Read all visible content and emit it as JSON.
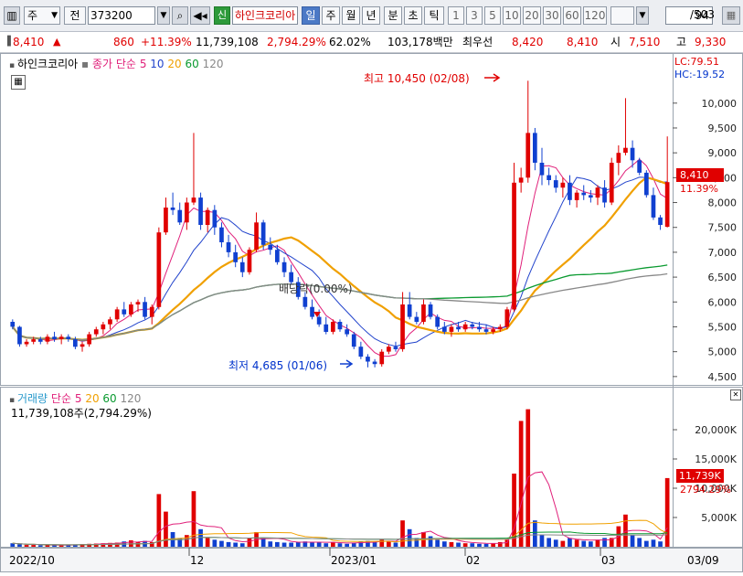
{
  "toolbar": {
    "market": "주",
    "jeon": "전",
    "code": "373200",
    "sin_badge": "신",
    "stock_name": "하인크코리아",
    "periods": [
      "일",
      "주",
      "월",
      "년",
      "분",
      "초",
      "틱"
    ],
    "selected_period": "일",
    "intervals": [
      "1",
      "3",
      "5",
      "10",
      "20",
      "30",
      "60",
      "120"
    ],
    "page": "94",
    "page_total": "/503"
  },
  "quote": {
    "price": "8,410",
    "up_mark": "▲",
    "change": "860",
    "change_rate": "+11.39%",
    "volume": "11,739,108",
    "volume_rate": "2,794.29%",
    "turnover": "62.02%",
    "amount": "103,178백만",
    "best_bid_label": "최우선",
    "best_bid": "8,420",
    "best_ask": "8,410",
    "open_label": "시",
    "open": "7,510",
    "high_label": "고",
    "high": "9,330"
  },
  "chart": {
    "name_label": "하인크코리아",
    "ma_label": "종가 단순",
    "ma_periods": [
      "5",
      "10",
      "20",
      "60",
      "120"
    ],
    "ma_colors": [
      "#e0207a",
      "#2244cc",
      "#f0a000",
      "#0a9a30",
      "#888888"
    ],
    "lc": "LC:79.51",
    "hc": "HC:-19.52",
    "annotation_high": "최고 10,450 (02/08)",
    "annotation_low": "최저 4,685 (01/06)",
    "annotation_ex_div": "배당락(0.00%)",
    "current_price_tag": "8,410",
    "current_rate_tag": "11.39%",
    "volume_label": "거래량",
    "volume_ma_label": "단순",
    "volume_ma_periods": [
      "5",
      "20",
      "60",
      "120"
    ],
    "volume_value": "11,739,108주(2,794.29%)",
    "volume_tag": "11,739K",
    "volume_rate_tag": "2794.29%",
    "date_labels": [
      "2022/10",
      "12",
      "2023/01",
      "02",
      "03",
      "03/09"
    ]
  },
  "chart_data": [
    {
      "type": "candlestick",
      "yaxis_ticks": [
        "10,000",
        "9,500",
        "9,000",
        "8,500",
        "8,000",
        "7,500",
        "7,000",
        "6,500",
        "6,000",
        "5,500",
        "5,000",
        "4,500"
      ],
      "ylim": [
        4350,
        10750
      ],
      "bars": [
        [
          5600,
          5650,
          5450,
          5500
        ],
        [
          5500,
          5520,
          5100,
          5150
        ],
        [
          5150,
          5250,
          5100,
          5200
        ],
        [
          5200,
          5300,
          5150,
          5250
        ],
        [
          5250,
          5300,
          5150,
          5200
        ],
        [
          5200,
          5350,
          5150,
          5300
        ],
        [
          5300,
          5400,
          5200,
          5250
        ],
        [
          5250,
          5350,
          5150,
          5300
        ],
        [
          5300,
          5350,
          5200,
          5250
        ],
        [
          5250,
          5300,
          5050,
          5100
        ],
        [
          5100,
          5200,
          5000,
          5150
        ],
        [
          5150,
          5400,
          5100,
          5350
        ],
        [
          5350,
          5500,
          5300,
          5450
        ],
        [
          5450,
          5600,
          5350,
          5550
        ],
        [
          5550,
          5700,
          5450,
          5650
        ],
        [
          5650,
          5900,
          5600,
          5850
        ],
        [
          5850,
          6000,
          5700,
          5750
        ],
        [
          5750,
          6000,
          5700,
          5950
        ],
        [
          5950,
          6050,
          5800,
          6000
        ],
        [
          6000,
          6100,
          5650,
          5700
        ],
        [
          5700,
          5950,
          5550,
          5900
        ],
        [
          5900,
          7500,
          5850,
          7400
        ],
        [
          7400,
          8100,
          7350,
          7900
        ],
        [
          7900,
          8200,
          7750,
          7850
        ],
        [
          7850,
          8000,
          7550,
          7600
        ],
        [
          7600,
          8100,
          7450,
          8000
        ],
        [
          8000,
          9400,
          7950,
          8100
        ],
        [
          8100,
          8200,
          7450,
          7550
        ],
        [
          7550,
          7900,
          7400,
          7850
        ],
        [
          7850,
          7950,
          7350,
          7500
        ],
        [
          7500,
          7600,
          7100,
          7200
        ],
        [
          7200,
          7350,
          6900,
          7000
        ],
        [
          7000,
          7150,
          6700,
          6800
        ],
        [
          6800,
          6900,
          6500,
          6600
        ],
        [
          6600,
          7100,
          6550,
          7050
        ],
        [
          7050,
          7800,
          7000,
          7600
        ],
        [
          7600,
          7650,
          7050,
          7150
        ],
        [
          7150,
          7300,
          6950,
          7050
        ],
        [
          7050,
          7150,
          6750,
          6800
        ],
        [
          6800,
          6900,
          6500,
          6600
        ],
        [
          6600,
          6750,
          6350,
          6400
        ],
        [
          6400,
          6500,
          6050,
          6100
        ],
        [
          6100,
          6200,
          5850,
          5900
        ],
        [
          5900,
          6050,
          5650,
          5700
        ],
        [
          5700,
          5850,
          5500,
          5550
        ],
        [
          5550,
          5700,
          5350,
          5400
        ],
        [
          5400,
          5650,
          5350,
          5600
        ],
        [
          5600,
          5650,
          5400,
          5450
        ],
        [
          5450,
          5550,
          5300,
          5350
        ],
        [
          5350,
          5400,
          5050,
          5100
        ],
        [
          5100,
          5200,
          4850,
          4900
        ],
        [
          4900,
          4950,
          4685,
          4800
        ],
        [
          4800,
          4850,
          4685,
          4750
        ],
        [
          4750,
          5050,
          4700,
          5000
        ],
        [
          5000,
          5150,
          4950,
          5100
        ],
        [
          5100,
          5200,
          5000,
          5050
        ],
        [
          5050,
          6200,
          5000,
          5950
        ],
        [
          5950,
          6200,
          5650,
          5700
        ],
        [
          5700,
          5800,
          5550,
          5600
        ],
        [
          5600,
          6050,
          5550,
          5950
        ],
        [
          5950,
          6000,
          5650,
          5700
        ],
        [
          5700,
          5750,
          5450,
          5500
        ],
        [
          5500,
          5600,
          5350,
          5400
        ],
        [
          5400,
          5550,
          5300,
          5500
        ],
        [
          5500,
          5600,
          5400,
          5450
        ],
        [
          5450,
          5600,
          5400,
          5550
        ],
        [
          5550,
          5600,
          5450,
          5500
        ],
        [
          5500,
          5600,
          5400,
          5450
        ],
        [
          5450,
          5550,
          5350,
          5400
        ],
        [
          5400,
          5500,
          5350,
          5450
        ],
        [
          5450,
          5550,
          5400,
          5500
        ],
        [
          5500,
          5900,
          5450,
          5850
        ],
        [
          5850,
          8800,
          5800,
          8400
        ],
        [
          8400,
          8700,
          8200,
          8500
        ],
        [
          8500,
          10450,
          8400,
          9400
        ],
        [
          9400,
          9500,
          8650,
          8800
        ],
        [
          8800,
          9100,
          8350,
          8550
        ],
        [
          8550,
          8700,
          8350,
          8450
        ],
        [
          8450,
          8550,
          8200,
          8300
        ],
        [
          8300,
          8500,
          8100,
          8400
        ],
        [
          8400,
          8550,
          7950,
          8050
        ],
        [
          8050,
          8250,
          7900,
          8200
        ],
        [
          8200,
          8350,
          8050,
          8150
        ],
        [
          8150,
          8250,
          8000,
          8100
        ],
        [
          8100,
          8350,
          7950,
          8300
        ],
        [
          8300,
          8450,
          7900,
          8000
        ],
        [
          8000,
          8900,
          7950,
          8800
        ],
        [
          8800,
          9150,
          8550,
          9000
        ],
        [
          9000,
          10100,
          8950,
          9100
        ],
        [
          9100,
          9250,
          8700,
          8850
        ],
        [
          8850,
          8900,
          8550,
          8600
        ],
        [
          8600,
          8650,
          8100,
          8150
        ],
        [
          8150,
          8300,
          7650,
          7700
        ],
        [
          7700,
          7750,
          7450,
          7550
        ],
        [
          7510,
          9330,
          7500,
          8410
        ]
      ]
    },
    {
      "type": "bar",
      "title": "거래량",
      "yaxis_ticks": [
        "20,000K",
        "15,000K",
        "10,000K",
        "5,000K"
      ],
      "ylim": [
        0,
        25000
      ],
      "values_k": [
        600,
        400,
        300,
        300,
        250,
        300,
        250,
        250,
        300,
        400,
        450,
        500,
        550,
        600,
        650,
        700,
        900,
        1100,
        800,
        1000,
        800,
        9000,
        6000,
        2500,
        1500,
        2000,
        9500,
        3000,
        1500,
        1200,
        1000,
        800,
        700,
        600,
        1500,
        2500,
        1500,
        900,
        800,
        700,
        700,
        800,
        900,
        800,
        700,
        600,
        800,
        600,
        500,
        700,
        900,
        1000,
        800,
        1200,
        900,
        700,
        4500,
        3000,
        1500,
        2500,
        1800,
        1200,
        900,
        800,
        700,
        600,
        600,
        500,
        500,
        600,
        800,
        1200,
        12500,
        21500,
        23500,
        4500,
        2000,
        1500,
        1200,
        1000,
        1500,
        1200,
        1000,
        900,
        1200,
        1500,
        1500,
        3500,
        5500,
        2000,
        1500,
        1000,
        1200,
        900,
        11739
      ]
    }
  ]
}
